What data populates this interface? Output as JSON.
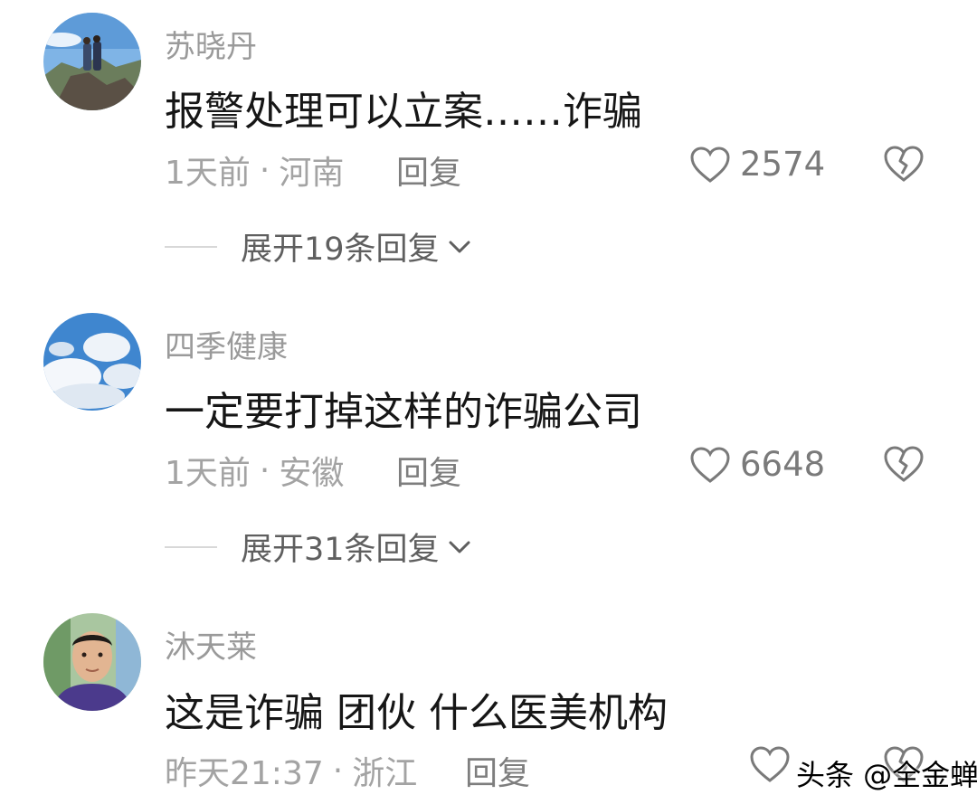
{
  "comments": [
    {
      "username": "苏晓丹",
      "text": "报警处理可以立案……诈骗",
      "time": "1天前",
      "separator": "·",
      "location": "河南",
      "reply_label": "回复",
      "likes": "2574",
      "expand_label": "展开19条回复"
    },
    {
      "username": "四季健康",
      "text": "一定要打掉这样的诈骗公司",
      "time": "1天前",
      "separator": "·",
      "location": "安徽",
      "reply_label": "回复",
      "likes": "6648",
      "expand_label": "展开31条回复"
    },
    {
      "username": "沐天莱",
      "text": "这是诈骗 团伙 什么医美机构",
      "time": "昨天21:37",
      "separator": "·",
      "location": "浙江",
      "reply_label": "回复"
    }
  ],
  "watermark": "头条 @全金蝉",
  "icons": {
    "like": "heart-outline-icon",
    "dislike": "broken-heart-icon",
    "expand": "chevron-down-icon"
  }
}
